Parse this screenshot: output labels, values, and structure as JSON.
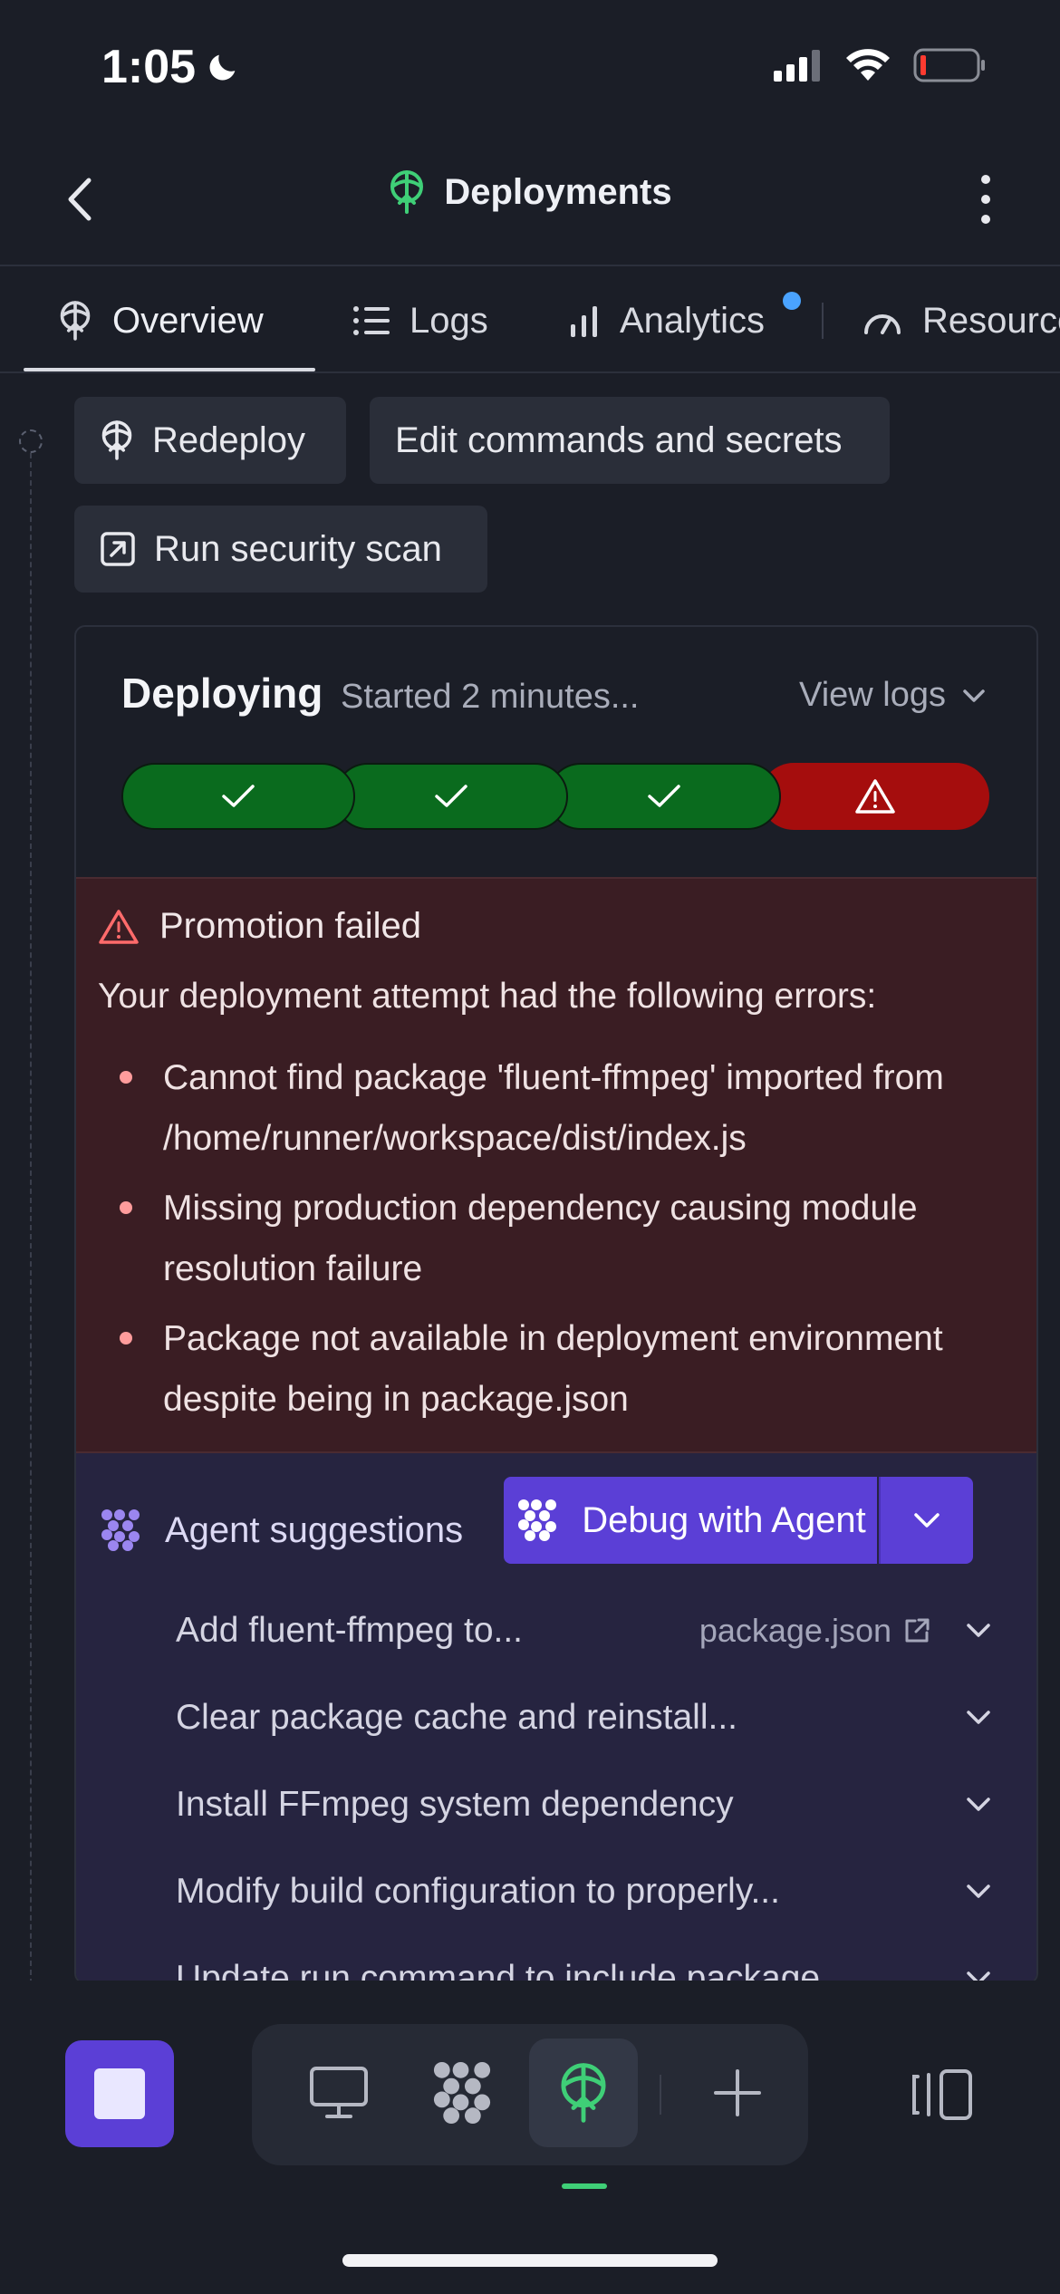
{
  "status_bar": {
    "time": "1:05"
  },
  "header": {
    "title": "Deployments"
  },
  "tabs": [
    {
      "label": "Overview",
      "icon": "deploy-icon",
      "active": true
    },
    {
      "label": "Logs",
      "icon": "list-icon"
    },
    {
      "label": "Analytics",
      "icon": "bar-chart-icon",
      "badge": true
    },
    {
      "label": "Resources",
      "icon": "gauge-icon"
    }
  ],
  "actions": {
    "redeploy": "Redeploy",
    "edit": "Edit commands and secrets",
    "scan": "Run security scan"
  },
  "deploy": {
    "status": "Deploying",
    "started": "Started 2 minutes...",
    "view_logs": "View logs",
    "steps": [
      "success",
      "success",
      "success",
      "error"
    ]
  },
  "error": {
    "title": "Promotion failed",
    "intro": "Your deployment attempt had the following errors:",
    "items": [
      "Cannot find package 'fluent-ffmpeg' imported from /home/runner/workspace/dist/index.js",
      "Missing production dependency causing module resolution failure",
      "Package not available in deployment environment despite being in package.json"
    ]
  },
  "agent": {
    "title": "Agent suggestions",
    "debug_label": "Debug with Agent",
    "suggestions": [
      {
        "text": "Add fluent-ffmpeg to...",
        "file": "package.json"
      },
      {
        "text": "Clear package cache and reinstall..."
      },
      {
        "text": "Install FFmpeg system dependency"
      },
      {
        "text": "Modify build configuration to properly..."
      },
      {
        "text": "Update run command to include package..."
      }
    ]
  },
  "colors": {
    "accent": "#5b3fd6",
    "success": "#0a6b1e",
    "error": "#a50d0d",
    "deploy_green": "#3fcf77"
  }
}
